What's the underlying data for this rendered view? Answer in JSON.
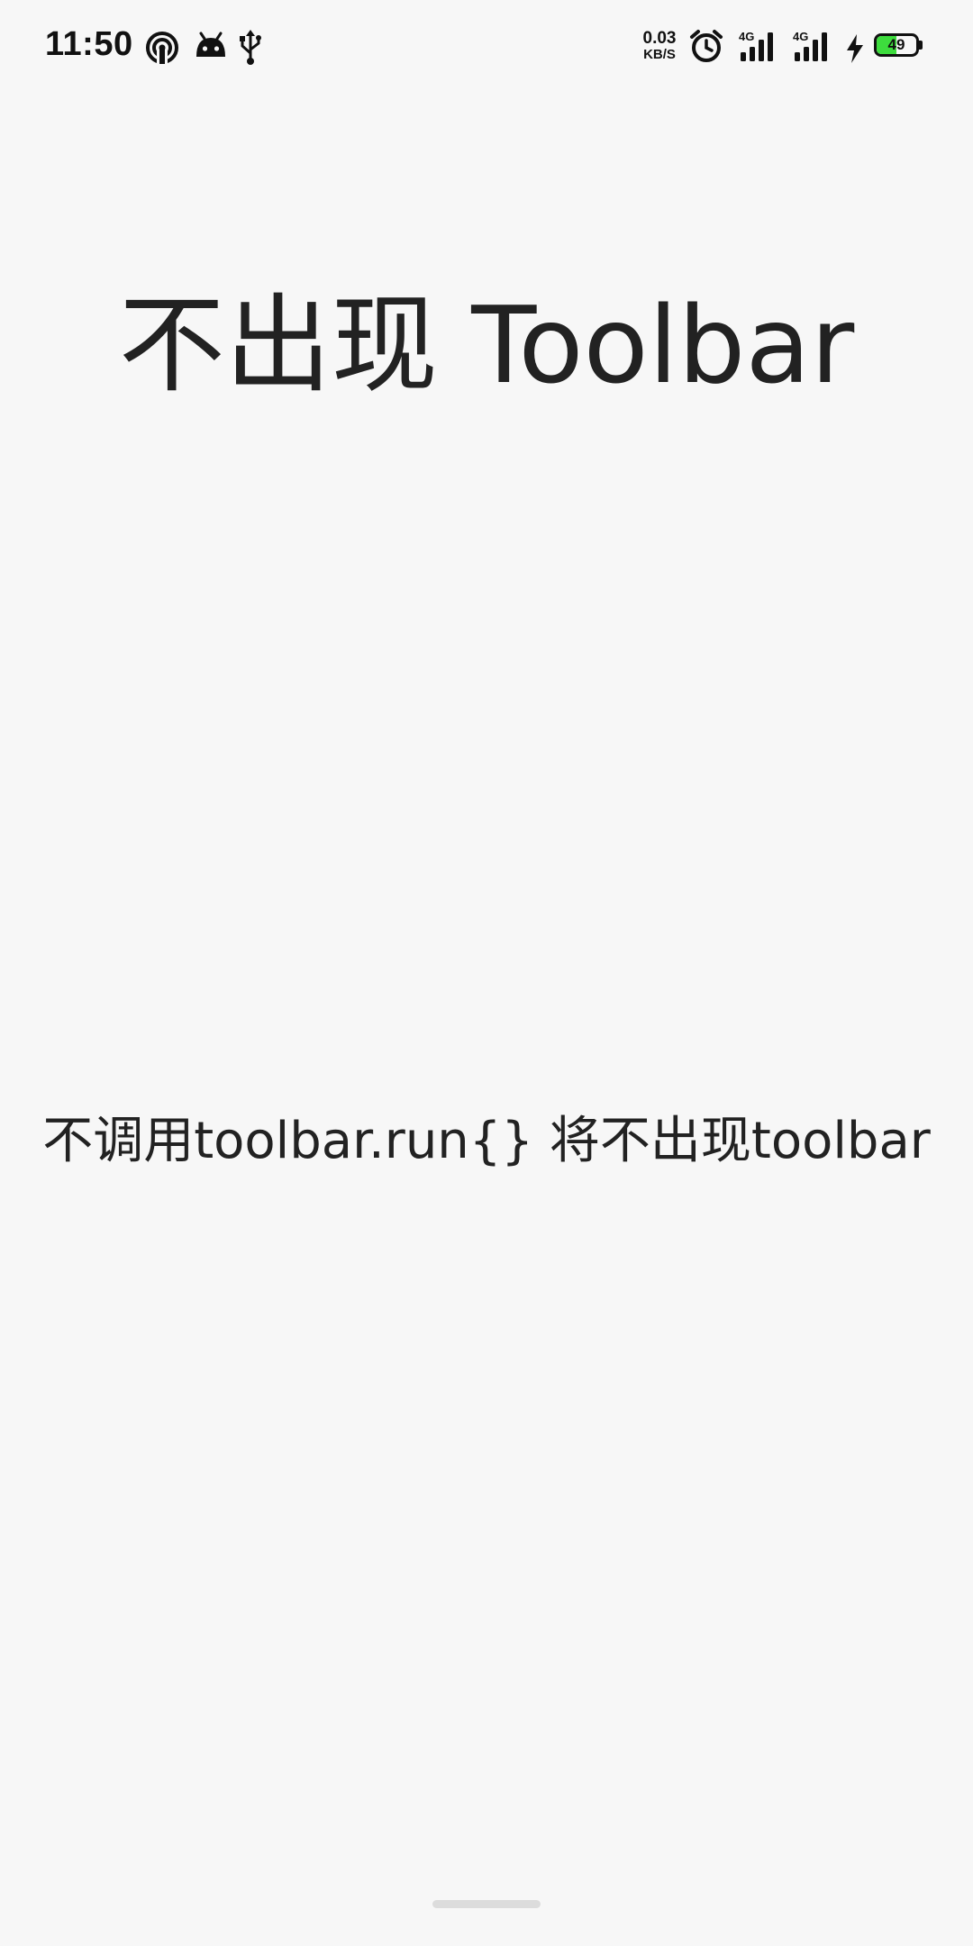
{
  "status_bar": {
    "time": "11:50",
    "icons": [
      "hotspot-icon",
      "android-icon",
      "usb-icon"
    ],
    "net_speed_value": "0.03",
    "net_speed_unit": "KB/S",
    "alarm_icon": "alarm-clock-icon",
    "signal_1_label": "4G",
    "signal_2_label": "4G",
    "charging_icon": "charging-bolt-icon",
    "battery_level": "49",
    "battery_fraction": 0.49,
    "battery_color": "#3ddc3d"
  },
  "main": {
    "title": "不出现 Toolbar",
    "description": "不调用toolbar.run{} 将不出现toolbar"
  },
  "colors": {
    "background": "#f7f7f7",
    "text": "#222222"
  }
}
